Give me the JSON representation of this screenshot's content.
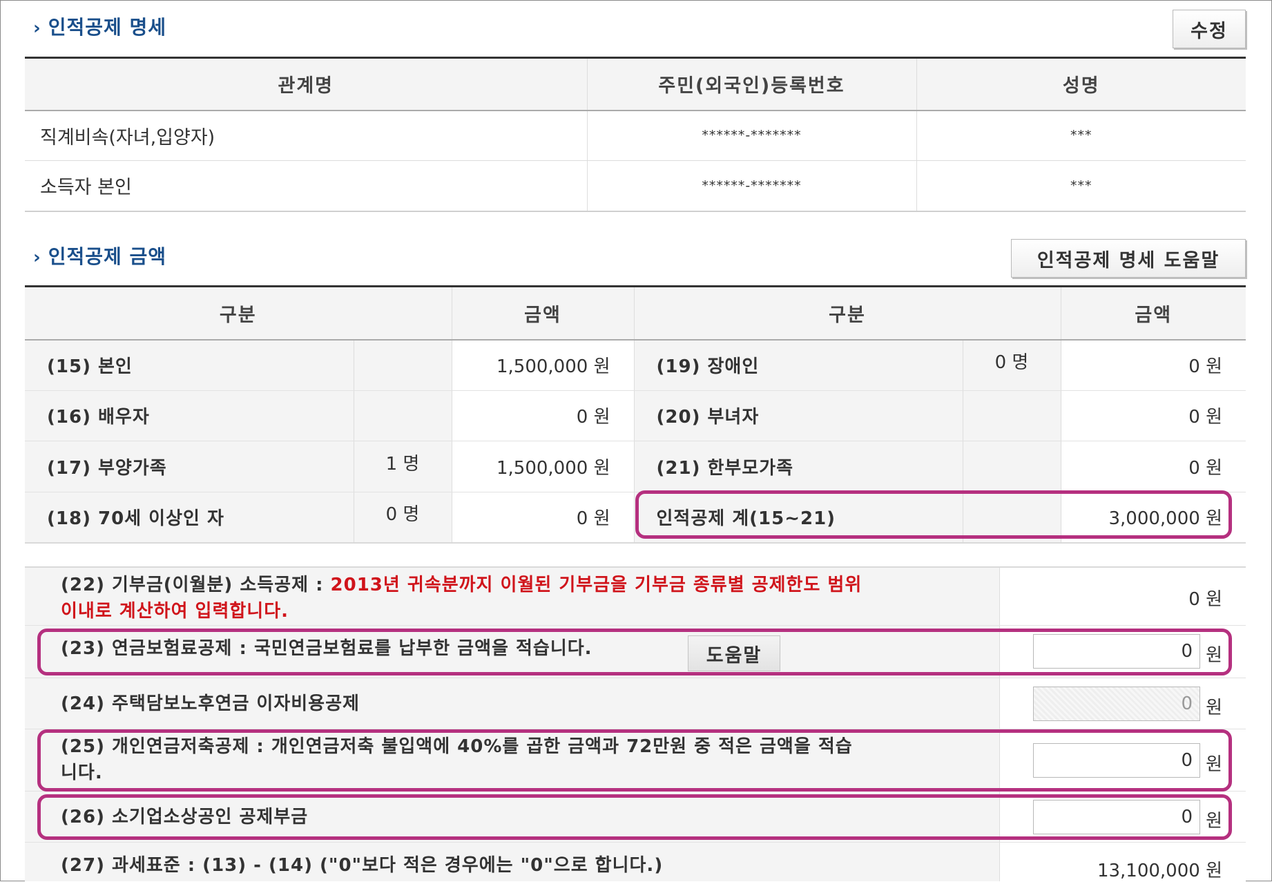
{
  "section1": {
    "title": "인적공제 명세",
    "edit_button": "수정",
    "headers": [
      "관계명",
      "주민(외국인)등록번호",
      "성명"
    ],
    "rows": [
      {
        "relation": "직계비속(자녀,입양자)",
        "id": "******-*******",
        "name": "***"
      },
      {
        "relation": "소득자 본인",
        "id": "******-*******",
        "name": "***"
      }
    ]
  },
  "section2": {
    "title": "인적공제 금액",
    "help_button": "인적공제 명세 도움말",
    "headers": [
      "구분",
      "금액",
      "구분",
      "금액"
    ],
    "rows": [
      {
        "left_label": "(15) 본인",
        "left_count": "",
        "left_amount": "1,500,000 원",
        "right_label": "(19) 장애인",
        "right_count": "0 명",
        "right_amount": "0 원"
      },
      {
        "left_label": "(16) 배우자",
        "left_count": "",
        "left_amount": "0 원",
        "right_label": "(20) 부녀자",
        "right_count": "",
        "right_amount": "0 원"
      },
      {
        "left_label": "(17) 부양가족",
        "left_count": "1 명",
        "left_amount": "1,500,000 원",
        "right_label": "(21) 한부모가족",
        "right_count": "",
        "right_amount": "0 원"
      },
      {
        "left_label": "(18) 70세 이상인 자",
        "left_count": "0 명",
        "left_amount": "0 원",
        "right_label": "인적공제 계(15~21)",
        "right_count": "",
        "right_amount": "3,000,000 원"
      }
    ]
  },
  "deductions": {
    "d22": {
      "label": "(22) 기부금(이월분) 소득공제 : ",
      "note_line1": "2013년 귀속분까지 이월된 기부금을 기부금 종류별 공제한도 범위",
      "note_line2": "이내로 계산하여 입력합니다.",
      "amount": "0 원"
    },
    "d23": {
      "label": "(23) 연금보험료공제 : 국민연금보험료를 납부한 금액을 적습니다.",
      "help": "도움말",
      "value": "0",
      "unit": "원"
    },
    "d24": {
      "label": "(24) 주택담보노후연금 이자비용공제",
      "value": "0",
      "unit": "원"
    },
    "d25": {
      "label_line1": "(25) 개인연금저축공제 : 개인연금저축 불입액에 40%를 곱한 금액과 72만원 중 적은 금액을 적습",
      "label_line2": "니다.",
      "value": "0",
      "unit": "원"
    },
    "d26": {
      "label": "(26) 소기업소상공인 공제부금",
      "value": "0",
      "unit": "원"
    },
    "d27": {
      "label": "(27) 과세표준 : (13) - (14) (\"0\"보다 적은 경우에는 \"0\"으로 합니다.)",
      "amount": "13,100,000 원"
    }
  },
  "colors": {
    "highlight": "#b5307f",
    "title": "#1a4f8b",
    "note_red": "#d0141b"
  }
}
